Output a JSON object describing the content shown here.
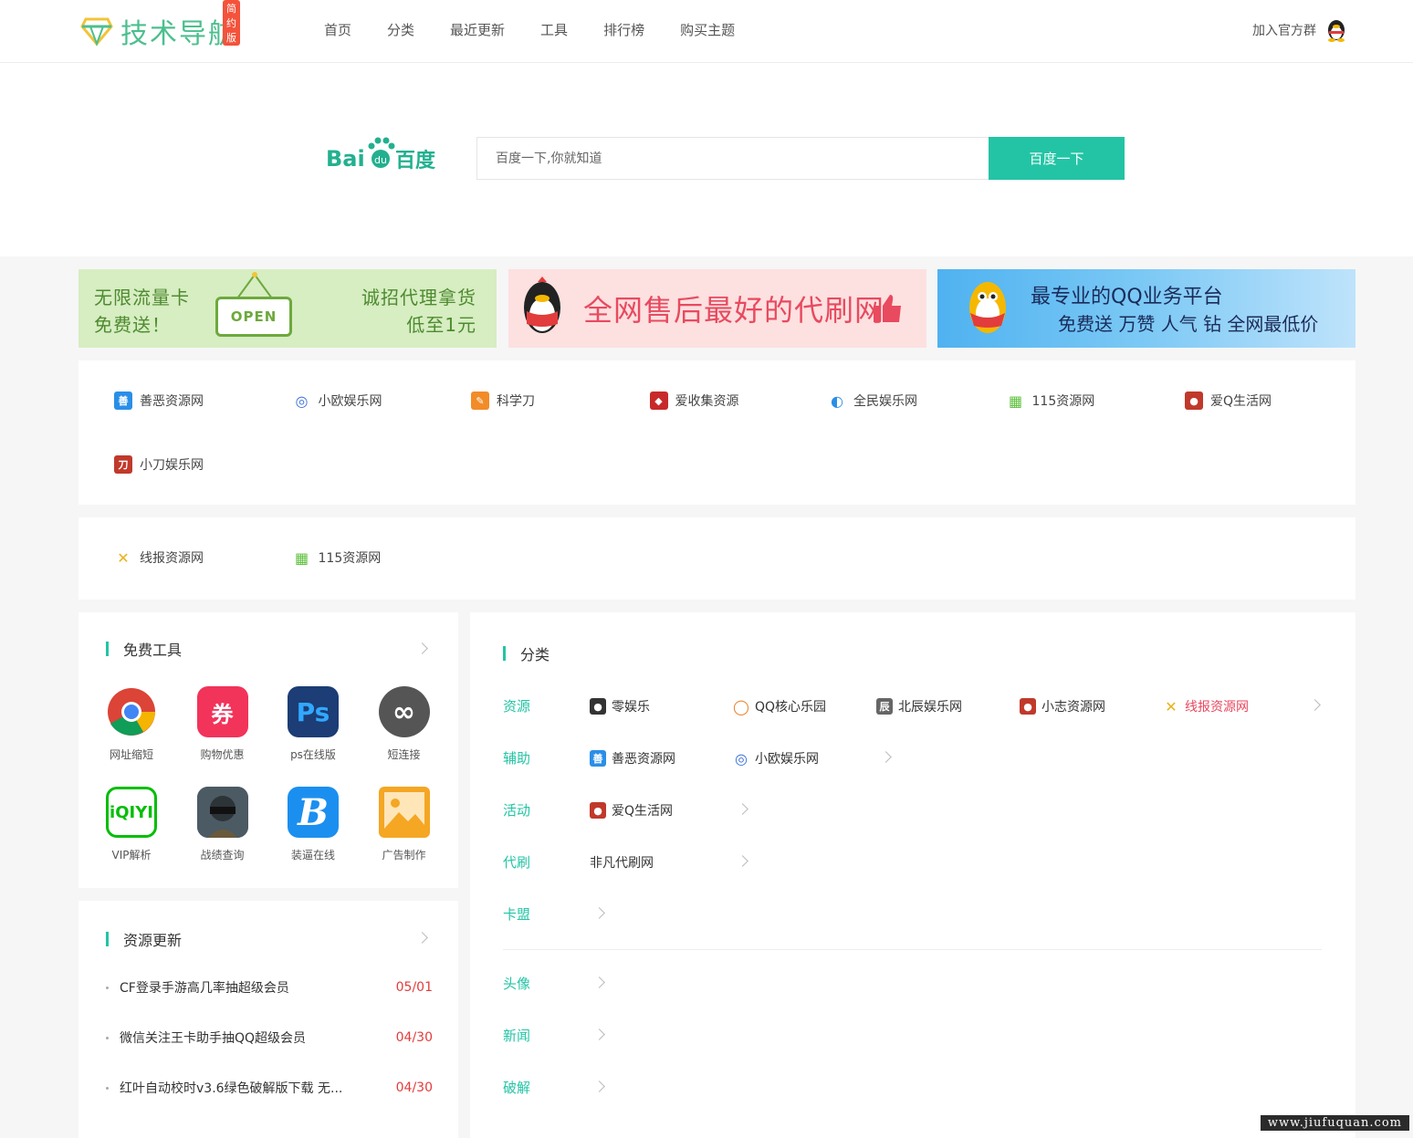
{
  "header": {
    "logo_text": "技术导航",
    "logo_badge": "简约版",
    "nav": [
      "首页",
      "分类",
      "最近更新",
      "工具",
      "排行榜",
      "购买主题"
    ],
    "join_label": "加入官方群"
  },
  "search": {
    "engine_name": "Bai百度",
    "placeholder": "百度一下,你就知道",
    "button_label": "百度一下"
  },
  "banners": [
    {
      "line1": "无限流量卡",
      "line2": "免费送！",
      "sign": "OPEN",
      "right1": "诚招代理拿货",
      "right2": "低至1元"
    },
    {
      "text": "全网售后最好的代刷网"
    },
    {
      "line1": "最专业的QQ业务平台",
      "line2": "免费送 万赞 人气 钻 全网最低价"
    }
  ],
  "featured_links": [
    {
      "label": "善恶资源网",
      "icon": "shane-icon",
      "color": "#2a8ee8"
    },
    {
      "label": "小欧娱乐网",
      "icon": "circle-icon",
      "color": "#3a6fd8"
    },
    {
      "label": "科学刀",
      "icon": "knife-icon",
      "color": "#f28c28"
    },
    {
      "label": "爱收集资源",
      "icon": "collect-icon",
      "color": "#c82a2a"
    },
    {
      "label": "全民娱乐网",
      "icon": "swirl-icon",
      "color": "#2a8ee8"
    },
    {
      "label": "115资源网",
      "icon": "grid-icon",
      "color": "#5bbf3a"
    },
    {
      "label": "爱Q生活网",
      "icon": "penguin-icon",
      "color": "#c0392b"
    },
    {
      "label": "小刀娱乐网",
      "icon": "xiaodao-icon",
      "color": "#c0392b"
    }
  ],
  "secondary_links": [
    {
      "label": "线报资源网",
      "icon": "cross-icon",
      "color": "#e8b21c"
    },
    {
      "label": "115资源网",
      "icon": "grid-icon",
      "color": "#5bbf3a"
    }
  ],
  "tools": {
    "title": "免费工具",
    "items": [
      {
        "label": "网址缩短",
        "icon": "chrome-icon",
        "glyph": "",
        "color": "#ffffff"
      },
      {
        "label": "购物优惠",
        "icon": "coupon-icon",
        "glyph": "券",
        "color": "#f2335a"
      },
      {
        "label": "ps在线版",
        "icon": "photoshop-icon",
        "glyph": "Ps",
        "color": "#1c3d75"
      },
      {
        "label": "短连接",
        "icon": "link-icon",
        "glyph": "∞",
        "color": "#555555"
      },
      {
        "label": "VIP解析",
        "icon": "iqiyi-icon",
        "glyph": "iQIYI",
        "color": "#ffffff"
      },
      {
        "label": "战绩查询",
        "icon": "pubg-icon",
        "glyph": "",
        "color": "#4b5a63"
      },
      {
        "label": "装逼在线",
        "icon": "b-icon",
        "glyph": "B",
        "color": "#1b8ff0"
      },
      {
        "label": "广告制作",
        "icon": "image-icon",
        "glyph": "",
        "color": "#f5a623"
      }
    ]
  },
  "updates": {
    "title": "资源更新",
    "items": [
      {
        "title": "CF登录手游高几率抽超级会员",
        "date": "05/01"
      },
      {
        "title": "微信关注王卡助手抽QQ超级会员",
        "date": "04/30"
      },
      {
        "title": "红叶自动校时v3.6绿色破解版下载 无...",
        "date": "04/30"
      }
    ]
  },
  "categories": {
    "title": "分类",
    "rows": [
      {
        "label": "资源",
        "links": [
          {
            "label": "零娱乐",
            "icon": "penguin-icon",
            "color": "#333333"
          },
          {
            "label": "QQ核心乐园",
            "icon": "ring-icon",
            "color": "#e8822a"
          },
          {
            "label": "北辰娱乐网",
            "icon": "beichen-icon",
            "color": "#666666"
          },
          {
            "label": "小志资源网",
            "icon": "penguin-icon",
            "color": "#c0392b"
          },
          {
            "label": "线报资源网",
            "icon": "cross-icon",
            "color": "#e8b21c",
            "highlight": true
          }
        ]
      },
      {
        "label": "辅助",
        "links": [
          {
            "label": "善恶资源网",
            "icon": "shane-icon",
            "color": "#2a8ee8"
          },
          {
            "label": "小欧娱乐网",
            "icon": "circle-icon",
            "color": "#3a6fd8"
          }
        ]
      },
      {
        "label": "活动",
        "links": [
          {
            "label": "爱Q生活网",
            "icon": "penguin-icon",
            "color": "#c0392b"
          }
        ]
      },
      {
        "label": "代刷",
        "links": [
          {
            "label": "非凡代刷网",
            "icon": "",
            "color": ""
          }
        ]
      },
      {
        "label": "卡盟",
        "links": []
      },
      {
        "label": "头像",
        "links": []
      },
      {
        "label": "新闻",
        "links": []
      },
      {
        "label": "破解",
        "links": []
      }
    ]
  },
  "watermark": "www.jiufuquan.com"
}
